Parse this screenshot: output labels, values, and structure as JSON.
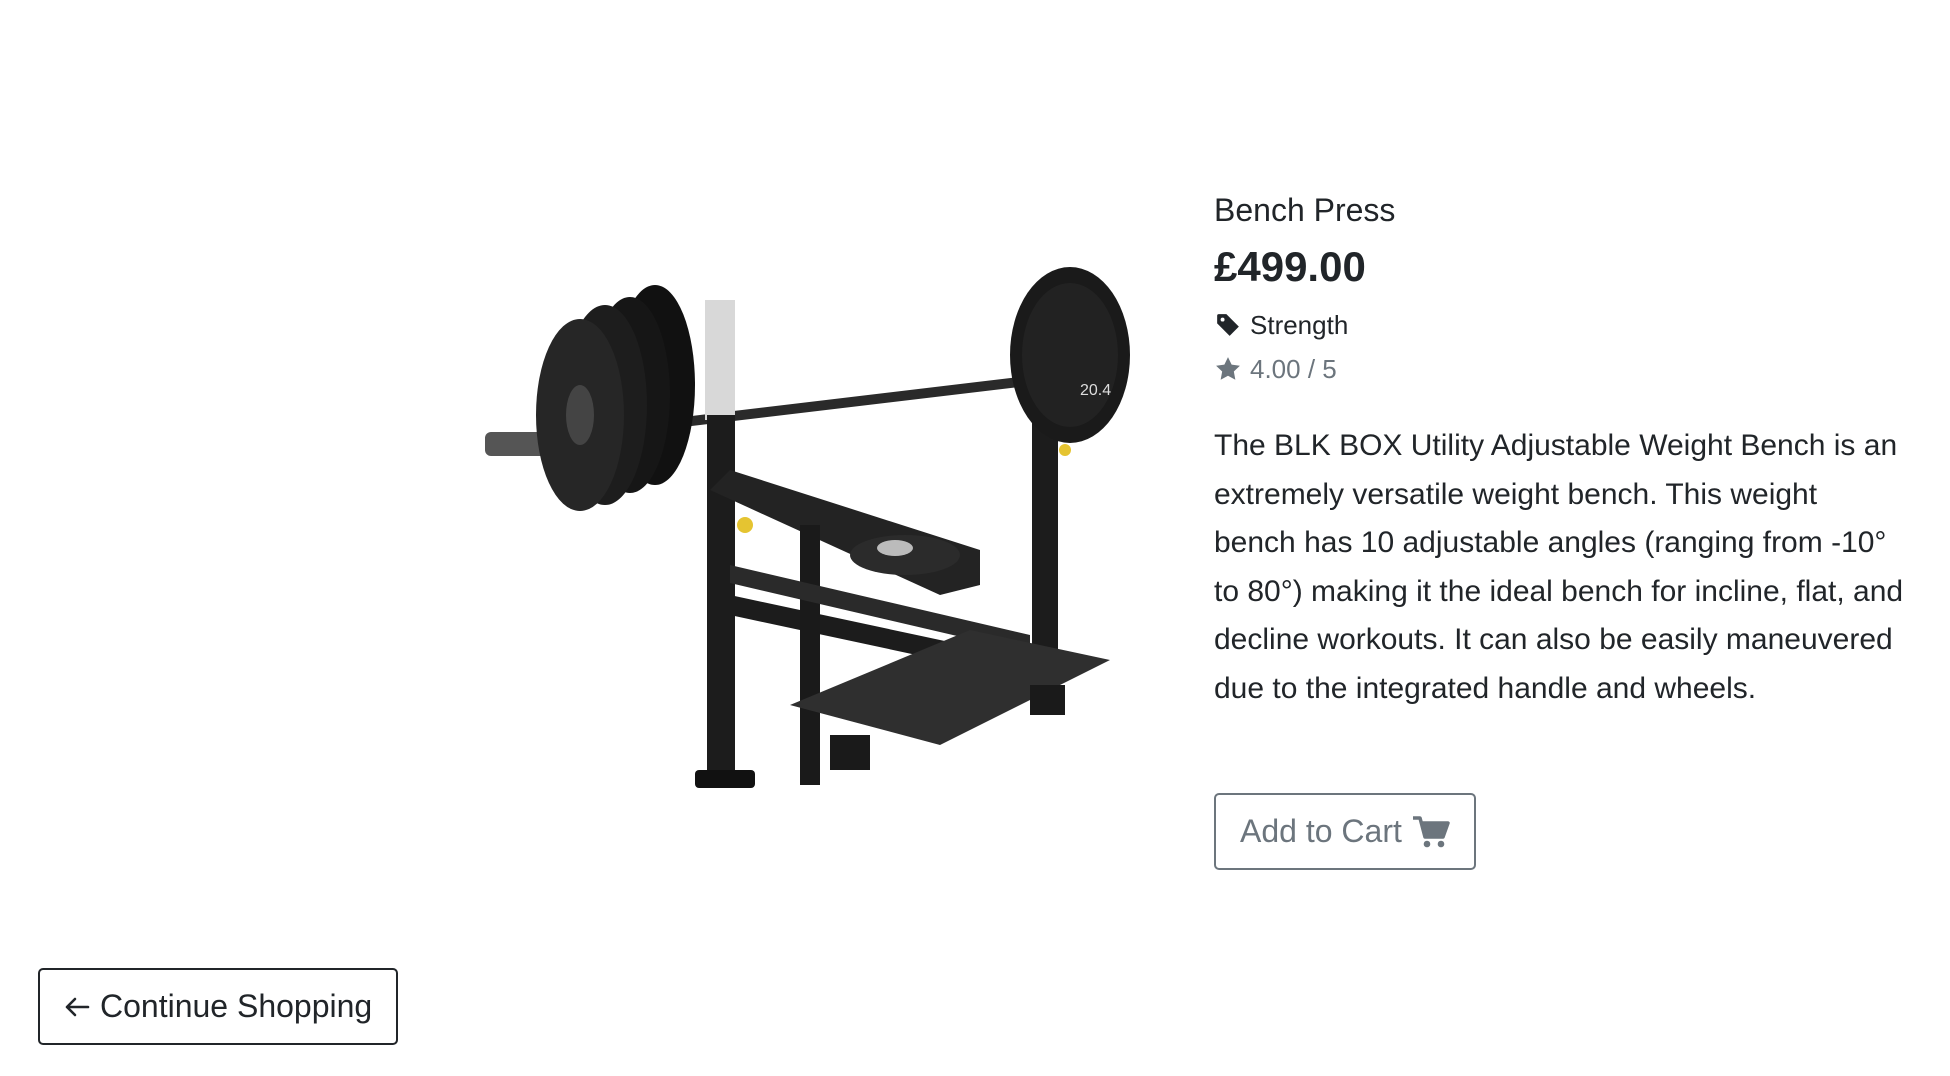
{
  "product": {
    "name": "Bench Press",
    "price": "£499.00",
    "category": "Strength",
    "rating": "4.00 / 5",
    "description": "The BLK BOX Utility Adjustable Weight Bench is an extremely versatile weight bench. This weight bench has 10 adjustable angles (ranging from -10° to 80°) making it the ideal bench for incline, flat, and decline workouts. It can also be easily maneuvered due to the integrated handle and wheels.",
    "image_icon": "bench-press-photo",
    "plate_label": "20.4"
  },
  "actions": {
    "add_to_cart_label": "Add to Cart",
    "continue_label": "Continue Shopping"
  },
  "icons": {
    "category": "tag-icon",
    "rating": "star-icon",
    "cart": "shopping-cart-icon",
    "back": "arrow-left-icon"
  },
  "colors": {
    "text": "#212529",
    "muted": "#6c757d"
  }
}
